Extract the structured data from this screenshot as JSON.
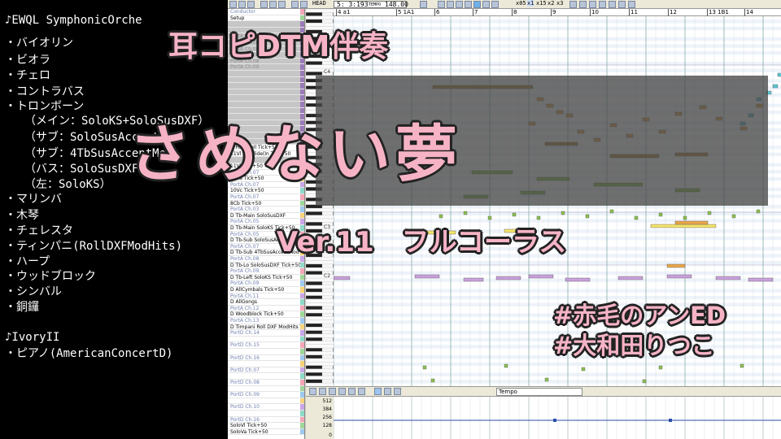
{
  "left_panel": {
    "lines": [
      "♪EWQL SymphonicOrche",
      "・バイオリン",
      "・ビオラ",
      "・チェロ",
      "・コントラバス",
      "・トロンボーン",
      "（メイン：SoloKS+SoloSusDXF）",
      "（サブ：SoloSusAccentMod）",
      "（サブ：4TbSusAccentMod）",
      "（バス：SoloSusDXF）",
      "（左：SoloKS）",
      "・マリンバ",
      "・木琴",
      "・チェレスタ",
      "・ティンパニ(RollDXFModHits)",
      "・ハープ",
      "・ウッドブロック",
      "・シンバル",
      "・銅鑼",
      "",
      "♪IvoryII",
      "・ピアノ(AmericanConcertD)"
    ]
  },
  "toolbar": {
    "position": "5: 3:193",
    "tempo_label": "TEMPO",
    "tempo_value": "148.00",
    "head_label": "HEAD",
    "zoom_labels": [
      "x05",
      "x1",
      "x15",
      "x2",
      "x3"
    ]
  },
  "ruler": {
    "measures": [
      "4 a1",
      "5 1A1",
      "6",
      "7",
      "8",
      "9",
      "10",
      "11",
      "12",
      "13 1B1",
      "14",
      "15"
    ]
  },
  "tracks": [
    {
      "label": "Conductor",
      "style": "blue"
    },
    {
      "label": "Setup",
      "style": "dark"
    },
    {
      "label": "",
      "style": "gray"
    },
    {
      "label": "",
      "style": "gray"
    },
    {
      "label": "PortA  Ch.05",
      "style": "gray"
    },
    {
      "label": "PortA  Ch.06",
      "style": "gray"
    },
    {
      "label": "PortA  Ch.06",
      "style": "gray"
    },
    {
      "label": "PortA  Ch.07",
      "style": "gray"
    },
    {
      "label": "PortA  Ch.08",
      "style": "gray"
    },
    {
      "label": "PortA  Ch.09",
      "style": "gray"
    },
    {
      "label": "",
      "style": "gray"
    },
    {
      "label": "",
      "style": "gray"
    },
    {
      "label": "",
      "style": "gray"
    },
    {
      "label": "",
      "style": "gray"
    },
    {
      "label": "",
      "style": "gray"
    },
    {
      "label": "",
      "style": "gray"
    },
    {
      "label": "",
      "style": "gray"
    },
    {
      "label": "",
      "style": "gray"
    },
    {
      "label": "",
      "style": "gray"
    },
    {
      "label": "",
      "style": "gray"
    },
    {
      "label": "",
      "style": "gray"
    },
    {
      "label": "",
      "style": "gray"
    },
    {
      "label": "N Harp roll Tick+50",
      "style": "dark"
    },
    {
      "label": "11Vl 6thSlide(In Tick+50",
      "style": "dark"
    },
    {
      "label": "",
      "style": "gray"
    },
    {
      "label": "11Vl Tick+50",
      "style": "dark"
    },
    {
      "label": "PortA  Ch.07",
      "style": "blue"
    },
    {
      "label": "10Va Tick+50",
      "style": "dark"
    },
    {
      "label": "PortA  Ch.07",
      "style": "blue"
    },
    {
      "label": "10Vc Tick+50",
      "style": "dark"
    },
    {
      "label": "PortA  Ch.07",
      "style": "blue"
    },
    {
      "label": "8Cb Tick+50",
      "style": "dark"
    },
    {
      "label": "PortA  Ch.03",
      "style": "blue"
    },
    {
      "label": "D Tb-Main SoloSusDXF",
      "style": "dark"
    },
    {
      "label": "PortA  Ch.05",
      "style": "blue"
    },
    {
      "label": "D Tb-Main SoloKS Tick+50",
      "style": "dark"
    },
    {
      "label": "PortA  Ch.05",
      "style": "blue"
    },
    {
      "label": "D Tb-Sub SoloSusAccentMod Ti",
      "style": "dark"
    },
    {
      "label": "PortA  Ch.07",
      "style": "blue"
    },
    {
      "label": "D Tb-Sub 4TbSusAccentMod Ti",
      "style": "dark"
    },
    {
      "label": "PortA  Ch.08",
      "style": "blue"
    },
    {
      "label": "D Tb-Lo SoloSusDXF Tick+50",
      "style": "dark"
    },
    {
      "label": "PortA  Ch.09",
      "style": "blue"
    },
    {
      "label": "D Tb-Left SoloKS Tick+50",
      "style": "dark"
    },
    {
      "label": "PortA  Ch.09",
      "style": "blue"
    },
    {
      "label": "D AllCymbals Tick+50",
      "style": "dark"
    },
    {
      "label": "PortA  Ch.11",
      "style": "blue"
    },
    {
      "label": "D AllGongs",
      "style": "dark"
    },
    {
      "label": "PortA  Ch.12",
      "style": "blue"
    },
    {
      "label": "D Woodblock Tick+50",
      "style": "dark"
    },
    {
      "label": "PortA  Ch.13",
      "style": "blue"
    },
    {
      "label": "D Timpani Roll DXF ModHits Ti",
      "style": "dark"
    },
    {
      "label": "PortD  Ch.14",
      "style": "blue"
    },
    {
      "label": "",
      "style": "dark"
    },
    {
      "label": "PortD  Ch.15",
      "style": "blue"
    },
    {
      "label": "",
      "style": "dark"
    },
    {
      "label": "PortD  Ch.16",
      "style": "blue"
    },
    {
      "label": "",
      "style": "dark"
    },
    {
      "label": "PortD  Ch.07",
      "style": "blue"
    },
    {
      "label": "",
      "style": "dark"
    },
    {
      "label": "PortD  Ch.08",
      "style": "blue"
    },
    {
      "label": "",
      "style": "dark"
    },
    {
      "label": "PortD  Ch.09",
      "style": "blue"
    },
    {
      "label": "",
      "style": "dark"
    },
    {
      "label": "PortD  Ch.10",
      "style": "blue"
    },
    {
      "label": "",
      "style": "dark"
    },
    {
      "label": "PortD  Ch.16",
      "style": "blue"
    },
    {
      "label": "SoloVl Tick+50",
      "style": "dark"
    },
    {
      "label": "SoloVa Tick+50",
      "style": "dark"
    }
  ],
  "piano_roll": {
    "octave_labels": [
      "C4",
      "C3",
      "C2"
    ]
  },
  "editbar": {
    "controller_select": "Tempo"
  },
  "velocity": {
    "scale": [
      "512",
      "384",
      "256",
      "128",
      "0"
    ]
  },
  "overlay": {
    "top_title": "耳コピDTM伴奏",
    "main_title": "さめない夢",
    "version": "Ver.11　フルコーラス",
    "hashtag1": "#赤毛のアンED",
    "hashtag2": "#大和田りつこ"
  },
  "colors": {
    "title_pink": "#f7b3c6",
    "outline": "#222222",
    "note_green": "#8bc34a",
    "note_yellow": "#f4e36a",
    "note_purple": "#c9a0dc",
    "note_orange": "#e8a64a",
    "note_cyan": "#5cc8d8",
    "note_brown": "#b48a3c"
  }
}
